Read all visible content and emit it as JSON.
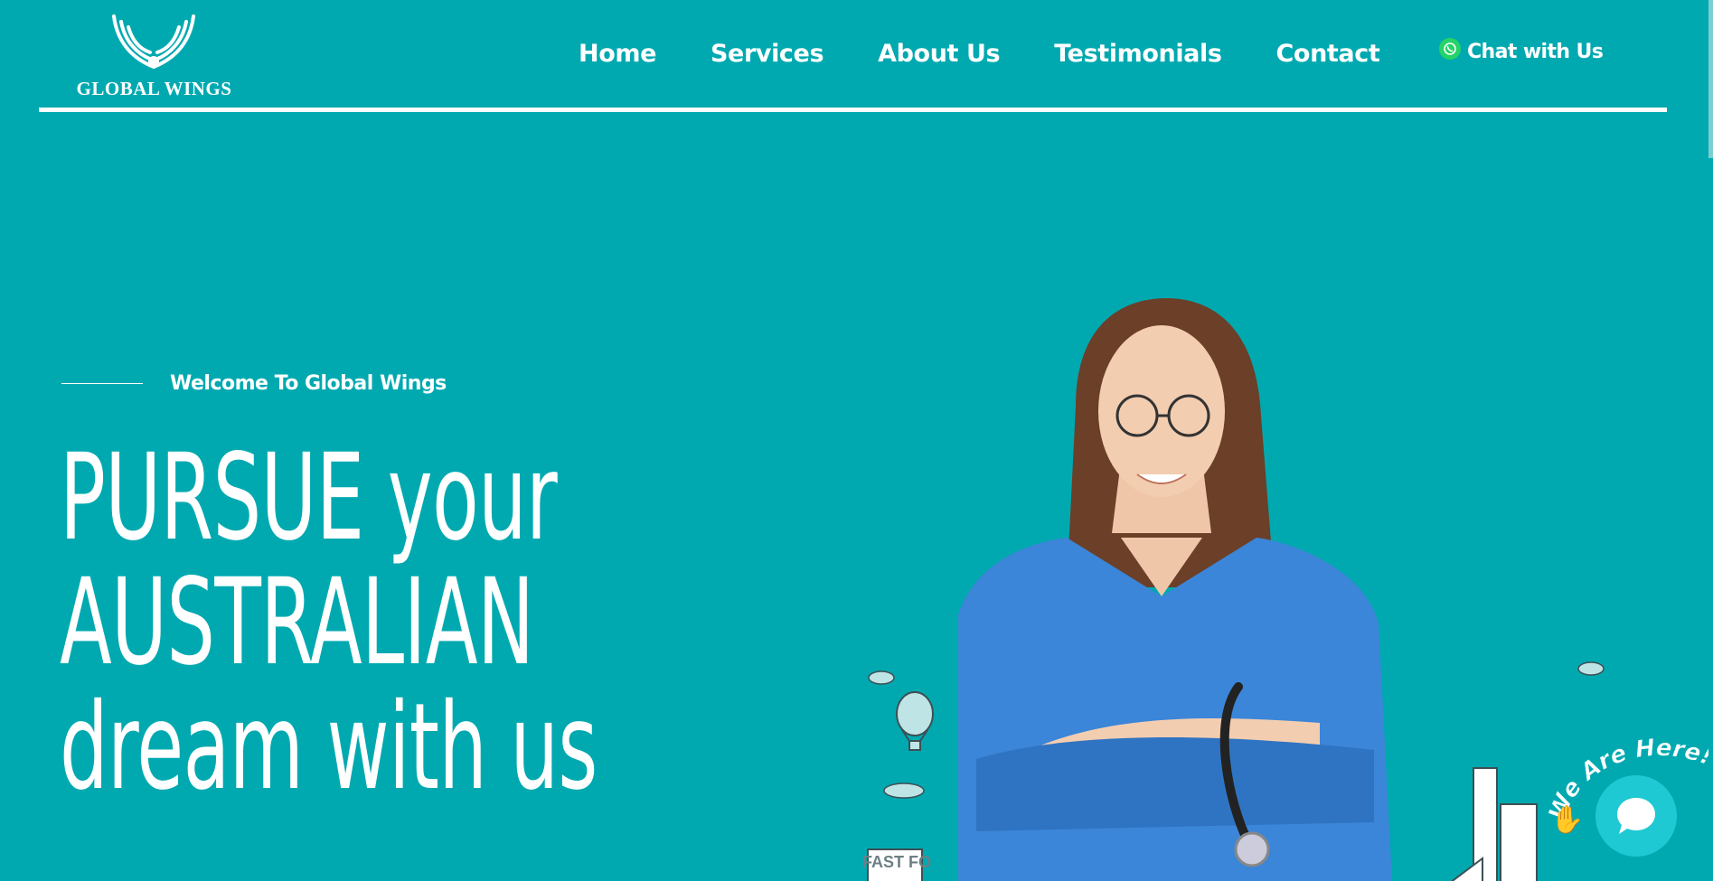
{
  "brand": {
    "name": "GLOBAL WINGS"
  },
  "nav": {
    "items": [
      {
        "label": "Home"
      },
      {
        "label": "Services"
      },
      {
        "label": "About Us"
      },
      {
        "label": "Testimonials"
      },
      {
        "label": "Contact"
      }
    ]
  },
  "header": {
    "chat_label": "Chat with Us"
  },
  "hero": {
    "welcome": "Welcome To Global Wings",
    "headline_lines": [
      "PURSUE your",
      "AUSTRALIAN",
      "dream with us"
    ],
    "illustration_text": "FAST FO"
  },
  "chat_widget": {
    "badge_text": "We Are Here!"
  },
  "colors": {
    "background": "#00a9b0",
    "scrub_blue": "#3b86d8",
    "chat_bubble": "#1ec9d3"
  },
  "icons": [
    "wings-logo-icon",
    "whatsapp-icon",
    "chat-bubble-icon",
    "wave-hand-icon"
  ]
}
